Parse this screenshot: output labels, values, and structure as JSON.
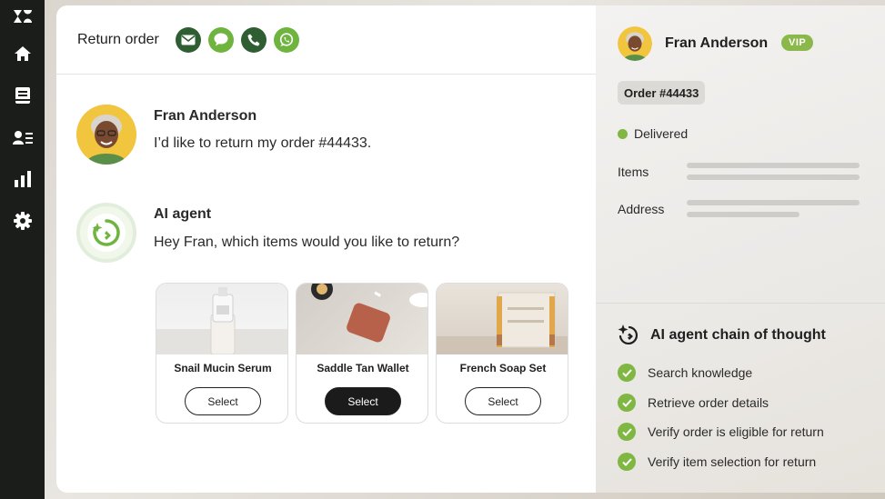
{
  "nav": {
    "items": [
      {
        "icon": "zendesk-logo-icon"
      },
      {
        "icon": "home-icon"
      },
      {
        "icon": "tickets-icon"
      },
      {
        "icon": "customers-icon"
      },
      {
        "icon": "reports-icon"
      },
      {
        "icon": "settings-icon"
      }
    ]
  },
  "conversation": {
    "title": "Return order",
    "channels": [
      {
        "icon": "email-icon",
        "color": "#2f5e33"
      },
      {
        "icon": "chat-icon",
        "color": "#6fb43f"
      },
      {
        "icon": "phone-icon",
        "color": "#2f5e33"
      },
      {
        "icon": "whatsapp-icon",
        "color": "#6fb43f"
      }
    ],
    "messages": [
      {
        "sender": "Fran Anderson",
        "text": "I’d like to return my order #44433."
      },
      {
        "sender": "AI agent",
        "text": "Hey Fran, which items would you like to return?"
      }
    ],
    "products": [
      {
        "name": "Snail Mucin Serum",
        "button": "Select",
        "selected": false
      },
      {
        "name": "Saddle Tan Wallet",
        "button": "Select",
        "selected": true
      },
      {
        "name": "French Soap Set",
        "button": "Select",
        "selected": false
      }
    ]
  },
  "customer": {
    "name": "Fran Anderson",
    "badge": "VIP",
    "order": "Order #44433",
    "status": "Delivered",
    "items_label": "Items",
    "address_label": "Address"
  },
  "chain_of_thought": {
    "title": "AI agent chain of thought",
    "steps": [
      "Search knowledge",
      "Retrieve order details",
      "Verify order is eligible for return",
      "Verify item selection for return"
    ]
  },
  "colors": {
    "accent_green": "#7fb742",
    "dark_green": "#2f5e33",
    "nav_bg": "#1b1d1b"
  }
}
